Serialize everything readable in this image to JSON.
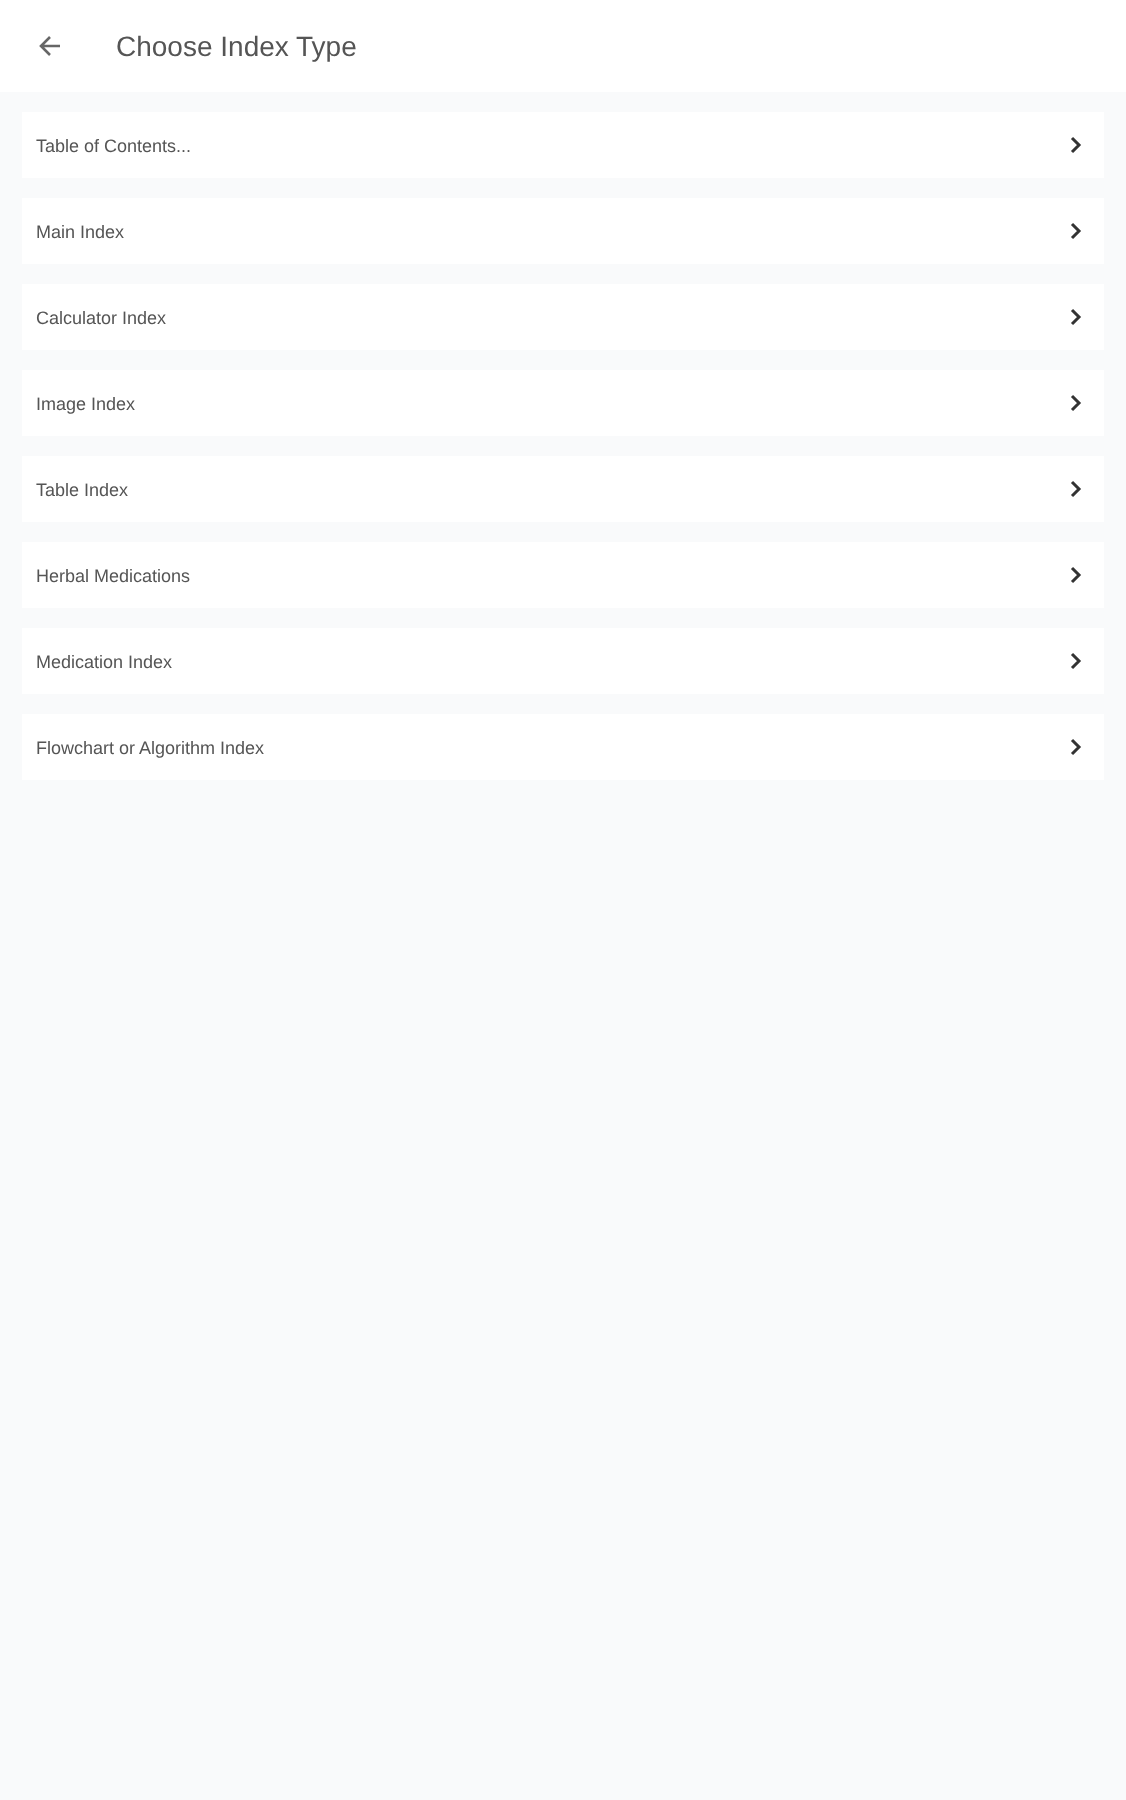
{
  "app_bar": {
    "title": "Choose Index Type"
  },
  "items": [
    {
      "label": "Table of Contents..."
    },
    {
      "label": "Main Index"
    },
    {
      "label": "Calculator Index"
    },
    {
      "label": "Image Index"
    },
    {
      "label": "Table Index"
    },
    {
      "label": "Herbal Medications"
    },
    {
      "label": "Medication Index"
    },
    {
      "label": "Flowchart or Algorithm Index"
    }
  ]
}
